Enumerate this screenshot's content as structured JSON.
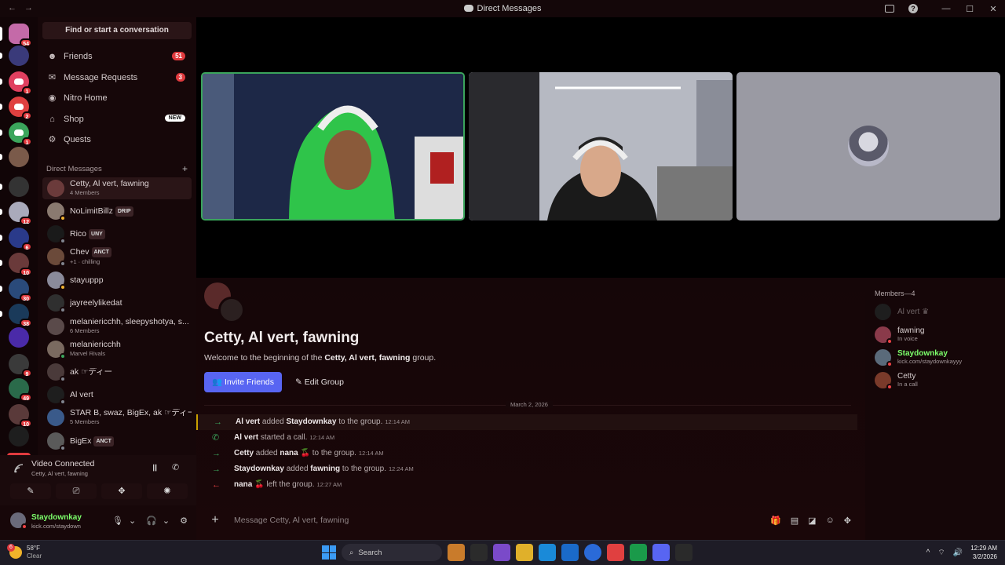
{
  "window": {
    "title": "Direct Messages",
    "back": "←",
    "forward": "→",
    "help": "?",
    "min": "—",
    "max": "☐",
    "close": "✕"
  },
  "rail": {
    "badges": [
      "54",
      "",
      "1",
      "2",
      "1",
      "",
      "",
      "12",
      "6",
      "10",
      "30",
      "38",
      "",
      "9",
      "49",
      "10",
      ""
    ],
    "new_label": "NEW"
  },
  "sidebar": {
    "search_label": "Find or start a conversation",
    "nav": [
      {
        "label": "Friends",
        "icon": "friends-icon",
        "glyph": "☻",
        "count": "51"
      },
      {
        "label": "Message Requests",
        "icon": "mail-icon",
        "glyph": "✉",
        "count": "3"
      },
      {
        "label": "Nitro Home",
        "icon": "nitro-icon",
        "glyph": "◉",
        "count": ""
      },
      {
        "label": "Shop",
        "icon": "shop-icon",
        "glyph": "⌂",
        "badge": "NEW"
      },
      {
        "label": "Quests",
        "icon": "quests-icon",
        "glyph": "⚙",
        "count": ""
      }
    ],
    "dm_header": "Direct Messages",
    "dm_add": "+",
    "dms": [
      {
        "name": "Cetty, Al vert, fawning",
        "sub": "4 Members",
        "tag": "",
        "color": "#6b3b3b",
        "status": ""
      },
      {
        "name": "NoLimitBillz",
        "sub": "",
        "tag": "DRIP",
        "color": "#8a7a70",
        "status": "#f0b232"
      },
      {
        "name": "Rico",
        "sub": "",
        "tag": "UNY",
        "color": "#1a1a1a",
        "status": "#80848e"
      },
      {
        "name": "Chev",
        "sub": "+1 · chilling",
        "tag": "ANCT",
        "color": "#6b4a3a",
        "status": "#80848e"
      },
      {
        "name": "stayuppp",
        "sub": "",
        "tag": "",
        "color": "#8a8a9a",
        "status": "#f0b232"
      },
      {
        "name": "jayreelylikedat",
        "sub": "",
        "tag": "",
        "color": "#2f2f2f",
        "status": "#80848e"
      },
      {
        "name": "melanie­ricchh, sleepyshotya, s...",
        "sub": "6 Members",
        "tag": "",
        "color": "#5a4a4a",
        "status": ""
      },
      {
        "name": "melanie­ricchh",
        "sub": "Marvel Rivals",
        "tag": "",
        "color": "#7a6a60",
        "status": "#3ba55c"
      },
      {
        "name": "ak ☞ディー",
        "sub": "",
        "tag": "",
        "color": "#4a3a3a",
        "status": "#80848e"
      },
      {
        "name": "Al vert",
        "sub": "",
        "tag": "",
        "color": "#1e1e1e",
        "status": "#80848e"
      },
      {
        "name": "STAR B, swaz, BigEx, ak ☞ディー",
        "sub": "5 Members",
        "tag": "",
        "color": "#3a5a8a",
        "status": ""
      },
      {
        "name": "BigEx",
        "sub": "",
        "tag": "ANCT",
        "color": "#5a5a5a",
        "status": "#80848e"
      }
    ]
  },
  "voice": {
    "status": "Video Connected",
    "channel": "Cetty, Al vert, fawning",
    "btn_icons": [
      "camera-off-icon",
      "screen-share-icon",
      "activities-icon",
      "soundboard-icon"
    ],
    "btn_glyphs": [
      "✎",
      "⎚",
      "✥",
      "✺"
    ]
  },
  "user": {
    "name": "Staydownkay",
    "status": "kick.com/staydown",
    "mic": "🎙",
    "headset": "🎧",
    "settings": "⚙",
    "caret": "⌄"
  },
  "stage": {
    "tiles": [
      "participant-tile-green-hoodie",
      "participant-tile-bedroom",
      "participant-tile-avatar-only"
    ]
  },
  "chat": {
    "title": "Cetty, Al vert, fawning",
    "welcome_pre": "Welcome to the beginning of the",
    "welcome_name": "Cetty, Al vert, fawning",
    "welcome_post": "group.",
    "invite_label": "Invite Friends",
    "edit_label": "Edit Group",
    "date": "March 2, 2026",
    "messages": [
      {
        "arrow": "→",
        "arrow_color": "#3ba55c",
        "actor": "Al vert",
        "verb": "added",
        "target": "Staydownkay",
        "rest": "to the group.",
        "time": "12:14 AM"
      },
      {
        "arrow": "✆",
        "arrow_color": "#3ba55c",
        "actor": "Al vert",
        "verb": "started a call.",
        "target": "",
        "rest": "",
        "time": "12:14 AM"
      },
      {
        "arrow": "→",
        "arrow_color": "#3ba55c",
        "actor": "Cetty",
        "verb": "added",
        "target": "nana 🍒",
        "rest": "to the group.",
        "time": "12:14 AM"
      },
      {
        "arrow": "→",
        "arrow_color": "#3ba55c",
        "actor": "Staydownkay",
        "verb": "added",
        "target": "fawning",
        "rest": "to the group.",
        "time": "12:24 AM"
      },
      {
        "arrow": "←",
        "arrow_color": "#ed4245",
        "actor": "nana 🍒",
        "verb": "left the group.",
        "target": "",
        "rest": "",
        "time": "12:27 AM"
      }
    ],
    "composer_placeholder": "Message Cetty, Al vert, fawning",
    "composer_plus": "+",
    "tool_icons": [
      "gift-icon",
      "gif-icon",
      "sticker-icon",
      "emoji-icon",
      "apps-icon"
    ],
    "tool_glyphs": [
      "🎁",
      "▤",
      "◪",
      "☺",
      "✥"
    ]
  },
  "members": {
    "header": "Members—4",
    "list": [
      {
        "name": "Al vert ♛",
        "sub": "",
        "color": "#1e1e1e",
        "name_color": "#6f6466"
      },
      {
        "name": "fawning",
        "sub": "In voice",
        "color": "#8a3a4a",
        "name_color": "#d8cfd0"
      },
      {
        "name": "Staydownkay",
        "sub": "kick.com/staydownkayyy",
        "color": "#5a6a7a",
        "name_color": "#7cff6b"
      },
      {
        "name": "Cetty",
        "sub": "In a call",
        "color": "#7a3a2a",
        "name_color": "#d8cfd0"
      }
    ]
  },
  "taskbar": {
    "temp": "58°F",
    "cond": "Clear",
    "weather_badge": "6",
    "search": "Search",
    "apps": [
      "#c97b2b",
      "#2b2b2b",
      "#7a4ac9",
      "#e0b02a",
      "#1a8ad8",
      "#1a6ac9",
      "#2a6ad8",
      "#e04040",
      "#1a9a4a",
      "#5865f2",
      "#2a2a2a"
    ],
    "time": "12:29 AM",
    "date": "3/2/2026"
  }
}
